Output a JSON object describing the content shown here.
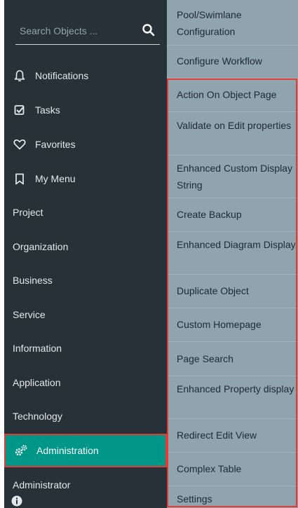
{
  "search": {
    "placeholder": "Search Objects ..."
  },
  "nav": {
    "notifications": "Notifications",
    "tasks": "Tasks",
    "favorites": "Favorites",
    "my_menu": "My Menu",
    "project": "Project",
    "organization": "Organization",
    "business": "Business",
    "service": "Service",
    "information": "Information",
    "application": "Application",
    "technology": "Technology",
    "administration": "Administration",
    "administrator": "Administrator"
  },
  "submenu": {
    "items": [
      "Pool/Swimlane Configuration",
      "Configure Workflow",
      "Action On Object Page",
      "Validate on Edit properties",
      "Enhanced Custom Display String",
      "Create Backup",
      "Enhanced Diagram Display",
      "Duplicate Object",
      "Custom Homepage",
      "Page Search",
      "Enhanced Property display",
      "Redirect Edit View",
      "Complex Table",
      "Settings"
    ]
  },
  "colors": {
    "sidebar_bg": "#263238",
    "active_bg": "#009688",
    "panel_bg": "#90a4ae",
    "highlight": "#e53935"
  },
  "icons": {
    "search": "search-icon",
    "notifications": "bell-icon",
    "tasks": "checkbox-icon",
    "favorites": "heart-icon",
    "my_menu": "bookmark-icon",
    "administration": "gears-icon",
    "info": "info-icon"
  }
}
